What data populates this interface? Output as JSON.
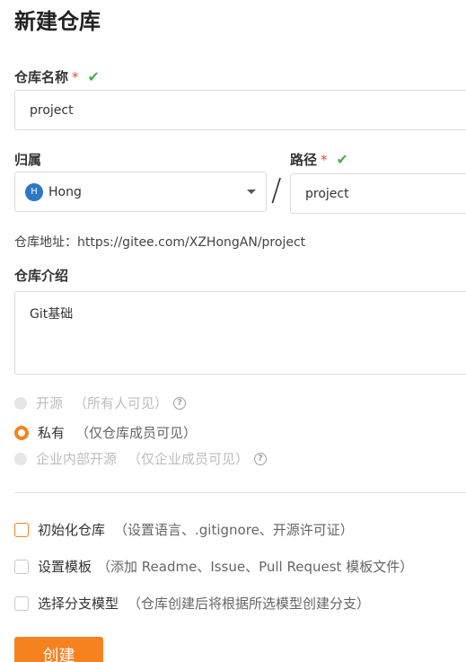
{
  "page_title": "新建仓库",
  "repo_name": {
    "label": "仓库名称",
    "required_mark": "*",
    "value": "project",
    "check_icon": "check-icon"
  },
  "owner": {
    "label": "归属",
    "avatar_letter": "H",
    "value": "Hong"
  },
  "separator": "/",
  "path": {
    "label": "路径",
    "required_mark": "*",
    "value": "project"
  },
  "repo_address": "仓库地址：https://gitee.com/XZHongAN/project",
  "description": {
    "label": "仓库介绍",
    "value": "Git基础"
  },
  "visibility": [
    {
      "label": "开源",
      "hint": "（所有人可见）",
      "state": "disabled",
      "help": "?"
    },
    {
      "label": "私有",
      "hint": "（仅仓库成员可见）",
      "state": "selected"
    },
    {
      "label": "企业内部开源",
      "hint": "（仅企业成员可见）",
      "state": "disabled",
      "help": "?"
    }
  ],
  "options": [
    {
      "label": "初始化仓库",
      "hint": "（设置语言、.gitignore、开源许可证）"
    },
    {
      "label": "设置模板",
      "hint": "（添加 Readme、Issue、Pull Request 模板文件）"
    },
    {
      "label": "选择分支模型",
      "hint": "（仓库创建后将根据所选模型创建分支）"
    }
  ],
  "submit_label": "创建",
  "colors": {
    "accent": "#f6821f",
    "check": "#4caf50",
    "required": "#e74c3c",
    "avatar": "#2e76c8"
  }
}
